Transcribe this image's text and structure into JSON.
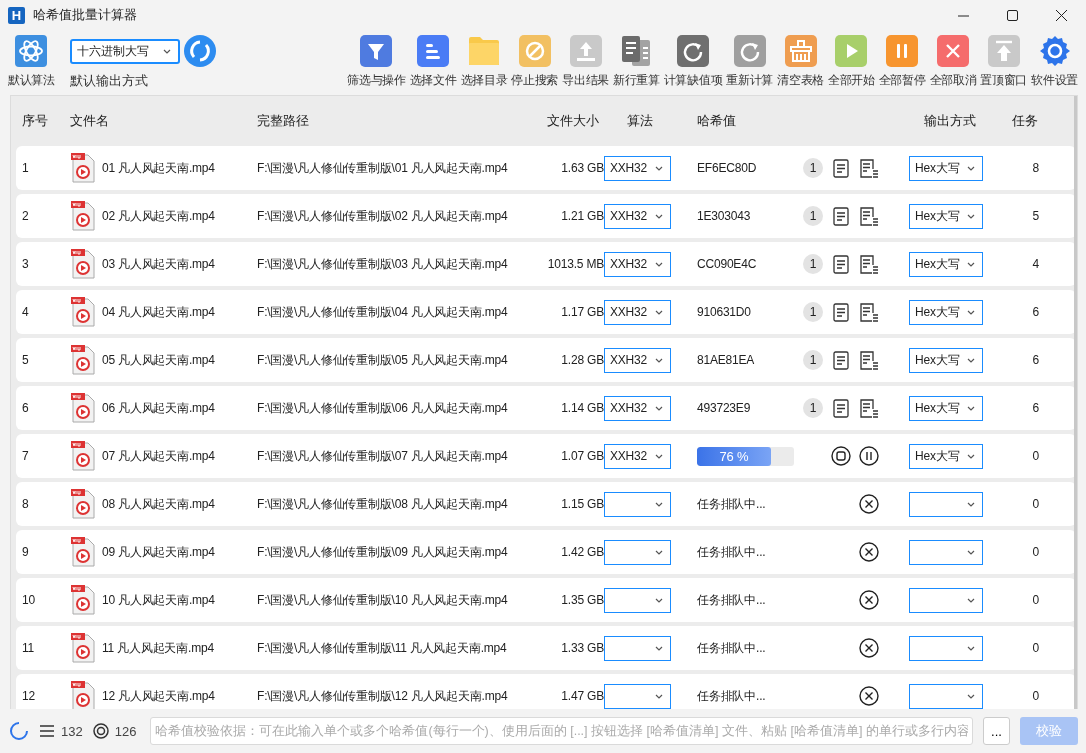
{
  "window": {
    "logo": "H",
    "title": "哈希值批量计算器"
  },
  "toolbar": {
    "algorithm_button": {
      "label": "默认算法"
    },
    "output_format": {
      "value": "十六进制大写",
      "label": "默认输出方式"
    },
    "buttons": [
      {
        "kind": "filter",
        "label": "筛选与操作"
      },
      {
        "kind": "files",
        "label": "选择文件"
      },
      {
        "kind": "folder",
        "label": "选择目录"
      },
      {
        "kind": "stop",
        "label": "停止搜索"
      },
      {
        "kind": "export",
        "label": "导出结果"
      },
      {
        "kind": "newline",
        "label": "新行重算"
      },
      {
        "kind": "missing",
        "label": "计算缺值项"
      },
      {
        "kind": "recalc",
        "label": "重新计算"
      },
      {
        "kind": "clear",
        "label": "清空表格"
      },
      {
        "kind": "start",
        "label": "全部开始"
      },
      {
        "kind": "pause",
        "label": "全部暂停"
      },
      {
        "kind": "cancel",
        "label": "全部取消"
      },
      {
        "kind": "pin",
        "label": "置顶窗口"
      },
      {
        "kind": "settings",
        "label": "软件设置"
      }
    ]
  },
  "table": {
    "columns": [
      "序号",
      "文件名",
      "完整路径",
      "文件大小",
      "算法",
      "哈希值",
      "输出方式",
      "任务"
    ],
    "rows": [
      {
        "kind": "done",
        "index": "1",
        "name": "01 凡人风起天南.mp4",
        "path": "F:\\国漫\\凡人修仙传重制版\\01 凡人风起天南.mp4",
        "size": "1.63 GB",
        "algorithm": "XXH32",
        "hash": "EF6EC80D",
        "count": "1",
        "output": "Hex大写",
        "task": "8"
      },
      {
        "kind": "done",
        "index": "2",
        "name": "02 凡人风起天南.mp4",
        "path": "F:\\国漫\\凡人修仙传重制版\\02 凡人风起天南.mp4",
        "size": "1.21 GB",
        "algorithm": "XXH32",
        "hash": "1E303043",
        "count": "1",
        "output": "Hex大写",
        "task": "5"
      },
      {
        "kind": "done",
        "index": "3",
        "name": "03 凡人风起天南.mp4",
        "path": "F:\\国漫\\凡人修仙传重制版\\03 凡人风起天南.mp4",
        "size": "1013.5 MB",
        "algorithm": "XXH32",
        "hash": "CC090E4C",
        "count": "1",
        "output": "Hex大写",
        "task": "4"
      },
      {
        "kind": "done",
        "index": "4",
        "name": "04 凡人风起天南.mp4",
        "path": "F:\\国漫\\凡人修仙传重制版\\04 凡人风起天南.mp4",
        "size": "1.17 GB",
        "algorithm": "XXH32",
        "hash": "910631D0",
        "count": "1",
        "output": "Hex大写",
        "task": "6"
      },
      {
        "kind": "done",
        "index": "5",
        "name": "05 凡人风起天南.mp4",
        "path": "F:\\国漫\\凡人修仙传重制版\\05 凡人风起天南.mp4",
        "size": "1.28 GB",
        "algorithm": "XXH32",
        "hash": "81AE81EA",
        "count": "1",
        "output": "Hex大写",
        "task": "6"
      },
      {
        "kind": "done",
        "index": "6",
        "name": "06 凡人风起天南.mp4",
        "path": "F:\\国漫\\凡人修仙传重制版\\06 凡人风起天南.mp4",
        "size": "1.14 GB",
        "algorithm": "XXH32",
        "hash": "493723E9",
        "count": "1",
        "output": "Hex大写",
        "task": "6"
      },
      {
        "kind": "running",
        "index": "7",
        "name": "07 凡人风起天南.mp4",
        "path": "F:\\国漫\\凡人修仙传重制版\\07 凡人风起天南.mp4",
        "size": "1.07 GB",
        "algorithm": "XXH32",
        "level": 0.76,
        "progress": "76 %",
        "output": "Hex大写",
        "task": "0"
      },
      {
        "kind": "queued",
        "index": "8",
        "name": "08 凡人风起天南.mp4",
        "path": "F:\\国漫\\凡人修仙传重制版\\08 凡人风起天南.mp4",
        "size": "1.15 GB",
        "status": "任务排队中...",
        "task": "0"
      },
      {
        "kind": "queued",
        "index": "9",
        "name": "09 凡人风起天南.mp4",
        "path": "F:\\国漫\\凡人修仙传重制版\\09 凡人风起天南.mp4",
        "size": "1.42 GB",
        "status": "任务排队中...",
        "task": "0"
      },
      {
        "kind": "queued",
        "index": "10",
        "name": "10 凡人风起天南.mp4",
        "path": "F:\\国漫\\凡人修仙传重制版\\10 凡人风起天南.mp4",
        "size": "1.35 GB",
        "status": "任务排队中...",
        "task": "0"
      },
      {
        "kind": "queued",
        "index": "11",
        "name": "11 凡人风起天南.mp4",
        "path": "F:\\国漫\\凡人修仙传重制版\\11 凡人风起天南.mp4",
        "size": "1.33 GB",
        "status": "任务排队中...",
        "task": "0"
      },
      {
        "kind": "queued",
        "index": "12",
        "name": "12 凡人风起天南.mp4",
        "path": "F:\\国漫\\凡人修仙传重制版\\12 凡人风起天南.mp4",
        "size": "1.47 GB",
        "status": "任务排队中...",
        "task": "0"
      }
    ]
  },
  "status_bar": {
    "total": "132",
    "done": "126",
    "verify_field": {
      "placeholder": "哈希值校验依据：可在此输入单个或多个哈希值(每行一个)、使用后面的 [...] 按钮选择 [哈希值清单] 文件、粘贴 [哈希值清单] 的单行或多行内容"
    },
    "browse_button": "...",
    "verify_button": {
      "label": "校验",
      "disabled": true
    }
  }
}
